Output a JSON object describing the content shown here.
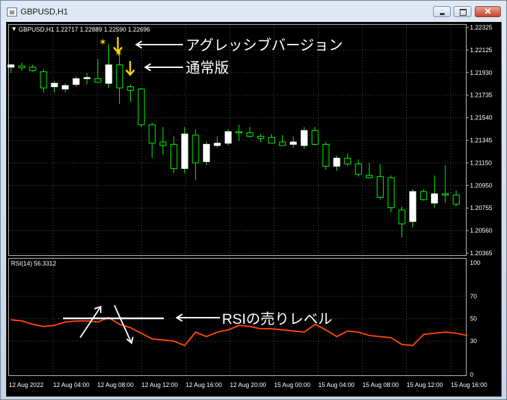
{
  "window": {
    "title": "GBPUSD,H1",
    "icon": "chart-window-icon",
    "buttons": {
      "minimize": "minimize-icon",
      "maximize": "maximize-icon",
      "close": "close-icon"
    }
  },
  "price_panel": {
    "header_arrow": "▼",
    "header": "GBPUSD,H1  1.22717 1.22889 1.22590 1.22696",
    "y_ticks": [
      "1.22325",
      "1.22125",
      "1.21930",
      "1.21735",
      "1.21540",
      "1.21345",
      "1.21150",
      "1.20950",
      "1.20755",
      "1.20560",
      "1.20365"
    ],
    "ylim": [
      1.20365,
      1.22325
    ]
  },
  "rsi_panel": {
    "header": "RSI(14) 56.3312",
    "y_ticks": [
      "100",
      "70",
      "50",
      "30",
      "0"
    ]
  },
  "x_ticks": [
    "12 Aug 2022",
    "12 Aug 04:00",
    "12 Aug 08:00",
    "12 Aug 12:00",
    "12 Aug 16:00",
    "12 Aug 20:00",
    "15 Aug 00:00",
    "15 Aug 04:00",
    "15 Aug 08:00",
    "15 Aug 12:00",
    "15 Aug 16:00"
  ],
  "annotations": {
    "aggressive": "アグレッシブバージョン",
    "normal": "通常版",
    "rsi_level": "RSIの売りレベル",
    "star_glyph": "✶"
  },
  "colors": {
    "background": "#000000",
    "bull_candle": "#ffffff",
    "wick": "#00ff00",
    "bear_candle": "#000000",
    "rsi_line": "#ff4500",
    "signal_arrow": "#ffd400",
    "grid": "#8a8a8a"
  },
  "chart_data": [
    {
      "type": "candlestick",
      "title": "GBPUSD,H1",
      "ylim": [
        1.20365,
        1.22325
      ],
      "candles": [
        {
          "o": 1.2198,
          "h": 1.2201,
          "l": 1.2193,
          "c": 1.22
        },
        {
          "o": 1.2199,
          "h": 1.2202,
          "l": 1.2195,
          "c": 1.21975
        },
        {
          "o": 1.2198,
          "h": 1.22,
          "l": 1.2194,
          "c": 1.2195
        },
        {
          "o": 1.2194,
          "h": 1.2196,
          "l": 1.2176,
          "c": 1.218
        },
        {
          "o": 1.2181,
          "h": 1.2186,
          "l": 1.2176,
          "c": 1.2184
        },
        {
          "o": 1.2179,
          "h": 1.2184,
          "l": 1.2176,
          "c": 1.2182
        },
        {
          "o": 1.2183,
          "h": 1.219,
          "l": 1.2181,
          "c": 1.2188
        },
        {
          "o": 1.2188,
          "h": 1.2193,
          "l": 1.2183,
          "c": 1.2189
        },
        {
          "o": 1.2188,
          "h": 1.2205,
          "l": 1.2186,
          "c": 1.2185
        },
        {
          "o": 1.2184,
          "h": 1.2218,
          "l": 1.218,
          "c": 1.22
        },
        {
          "o": 1.22,
          "h": 1.2213,
          "l": 1.2166,
          "c": 1.218
        },
        {
          "o": 1.2181,
          "h": 1.2183,
          "l": 1.2168,
          "c": 1.2178
        },
        {
          "o": 1.2179,
          "h": 1.218,
          "l": 1.2146,
          "c": 1.2148
        },
        {
          "o": 1.2148,
          "h": 1.215,
          "l": 1.2119,
          "c": 1.2132
        },
        {
          "o": 1.2133,
          "h": 1.2146,
          "l": 1.2122,
          "c": 1.213
        },
        {
          "o": 1.2131,
          "h": 1.2138,
          "l": 1.2106,
          "c": 1.211
        },
        {
          "o": 1.211,
          "h": 1.2146,
          "l": 1.2106,
          "c": 1.214
        },
        {
          "o": 1.2139,
          "h": 1.2144,
          "l": 1.21,
          "c": 1.2115
        },
        {
          "o": 1.2116,
          "h": 1.2133,
          "l": 1.2113,
          "c": 1.2131
        },
        {
          "o": 1.213,
          "h": 1.2138,
          "l": 1.2128,
          "c": 1.2132
        },
        {
          "o": 1.2132,
          "h": 1.2144,
          "l": 1.213,
          "c": 1.2142
        },
        {
          "o": 1.2142,
          "h": 1.2148,
          "l": 1.2134,
          "c": 1.2141
        },
        {
          "o": 1.2141,
          "h": 1.2146,
          "l": 1.2137,
          "c": 1.2138
        },
        {
          "o": 1.2138,
          "h": 1.214,
          "l": 1.2133,
          "c": 1.2136
        },
        {
          "o": 1.2137,
          "h": 1.214,
          "l": 1.2132,
          "c": 1.2132
        },
        {
          "o": 1.2133,
          "h": 1.2139,
          "l": 1.213,
          "c": 1.213
        },
        {
          "o": 1.2131,
          "h": 1.2138,
          "l": 1.2128,
          "c": 1.2133
        },
        {
          "o": 1.213,
          "h": 1.2146,
          "l": 1.2127,
          "c": 1.2143
        },
        {
          "o": 1.2143,
          "h": 1.2146,
          "l": 1.213,
          "c": 1.2131
        },
        {
          "o": 1.2131,
          "h": 1.2133,
          "l": 1.2109,
          "c": 1.2112
        },
        {
          "o": 1.2112,
          "h": 1.2121,
          "l": 1.2108,
          "c": 1.2119
        },
        {
          "o": 1.2119,
          "h": 1.2123,
          "l": 1.2112,
          "c": 1.2114
        },
        {
          "o": 1.2114,
          "h": 1.2118,
          "l": 1.2103,
          "c": 1.2105
        },
        {
          "o": 1.2104,
          "h": 1.2115,
          "l": 1.2102,
          "c": 1.2102
        },
        {
          "o": 1.2103,
          "h": 1.2114,
          "l": 1.2083,
          "c": 1.2085
        },
        {
          "o": 1.2102,
          "h": 1.2104,
          "l": 1.2072,
          "c": 1.2076
        },
        {
          "o": 1.2074,
          "h": 1.2077,
          "l": 1.205,
          "c": 1.2062
        },
        {
          "o": 1.2064,
          "h": 1.2092,
          "l": 1.2059,
          "c": 1.209
        },
        {
          "o": 1.209,
          "h": 1.2092,
          "l": 1.2082,
          "c": 1.2083
        },
        {
          "o": 1.208,
          "h": 1.2104,
          "l": 1.2076,
          "c": 1.2088
        },
        {
          "o": 1.2088,
          "h": 1.2113,
          "l": 1.208,
          "c": 1.2087
        },
        {
          "o": 1.2087,
          "h": 1.2091,
          "l": 1.2077,
          "c": 1.2079
        }
      ]
    },
    {
      "type": "line",
      "title": "RSI(14) 56.3312",
      "ylim": [
        0,
        100
      ],
      "series": [
        {
          "name": "RSI(14)",
          "values": [
            49,
            48,
            45,
            43,
            44,
            47,
            48,
            48,
            47,
            51,
            45,
            42,
            37,
            32,
            31,
            30,
            26,
            38,
            34,
            38,
            40,
            44,
            43,
            41,
            41,
            40,
            39,
            38,
            45,
            40,
            34,
            39,
            38,
            35,
            34,
            33,
            27,
            26,
            36,
            37,
            38,
            37,
            35
          ]
        }
      ],
      "levels": [
        70,
        50,
        30
      ]
    }
  ]
}
